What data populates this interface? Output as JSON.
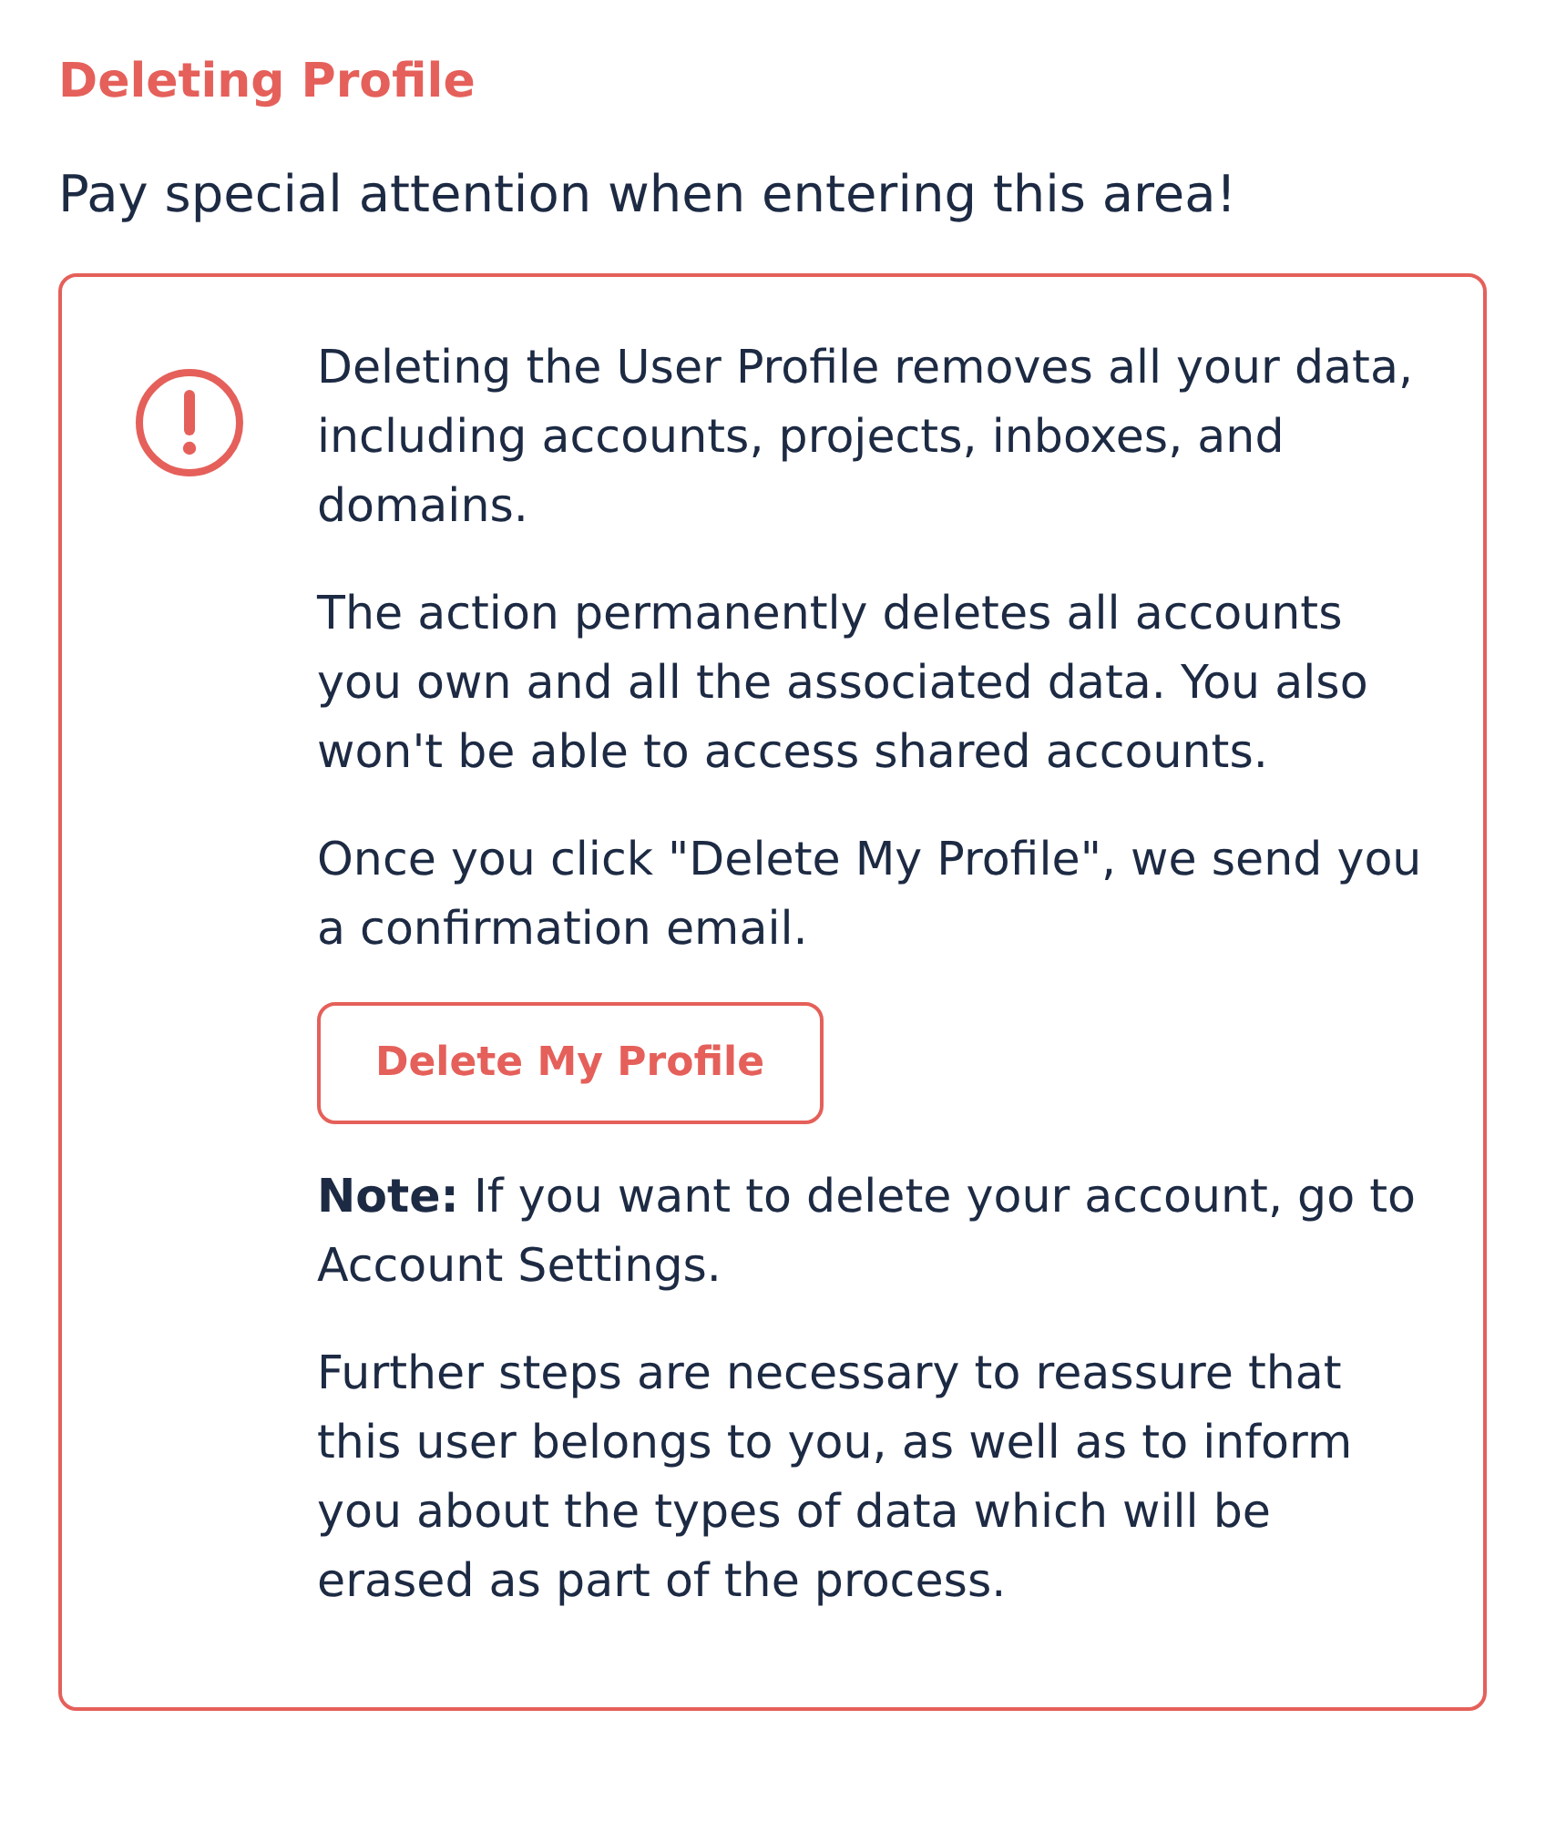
{
  "title": "Deleting Profile",
  "subtitle": "Pay special attention when entering this area!",
  "alert": {
    "blocks": [
      {
        "kind": "paragraph",
        "text": "Deleting the User Profile removes all your data, including accounts, projects, inboxes, and domains."
      },
      {
        "kind": "paragraph",
        "text": "The action permanently deletes all accounts you own and all the associated data. You also won't be able to access shared accounts."
      },
      {
        "kind": "paragraph",
        "text": "Once you click \"Delete My Profile\", we send you a confirmation email."
      },
      {
        "kind": "button",
        "label": "Delete My Profile"
      },
      {
        "kind": "paragraph",
        "text": "**Note:** If you want to delete your account, go to Account Settings."
      },
      {
        "kind": "paragraph",
        "text": "Further steps are necessary to reassure that this user belongs to you, as well as to inform you about the types of data which will be erased as part of the process."
      }
    ]
  }
}
